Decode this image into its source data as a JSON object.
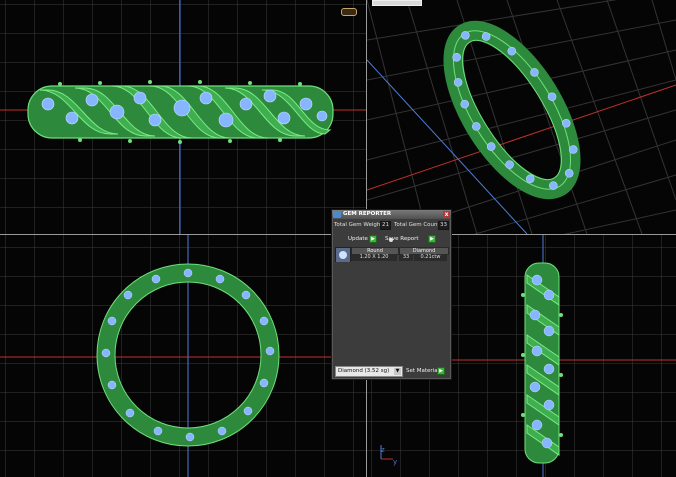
{
  "panel": {
    "title": "GEM REPORTER",
    "close_label": "x",
    "total_weight_label": "Total Gem Weight",
    "total_weight_value": "21",
    "total_count_label": "Total Gem Count",
    "total_count_value": "33",
    "update_label": "Update",
    "save_report_label": "Save Report",
    "button_glyph": "▶",
    "table": {
      "headers": [
        "Round",
        "Diamond"
      ],
      "row": {
        "size": "1.20 X 1.20",
        "count": "33",
        "weight": "0.21ctw"
      }
    },
    "material_select": "Diamond   (3.52 sg)",
    "material_chevron": "▼",
    "set_material_label": "Set Material"
  },
  "axis": {
    "z_label": "z",
    "y_label": "y"
  },
  "colors": {
    "ring_green": "#3fae4f",
    "gem_blue": "#7fb0ff",
    "grid": "#3a3a3a",
    "axis_red": "#c23030",
    "axis_blue": "#4f7bd6"
  },
  "icons": {
    "viewport_icon": "ring-thumbnail-icon"
  }
}
